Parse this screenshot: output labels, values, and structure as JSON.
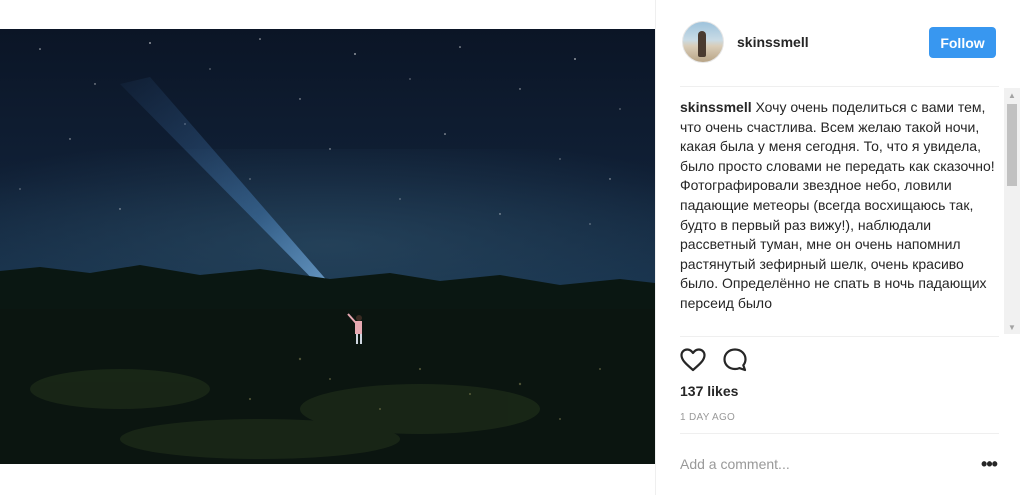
{
  "post": {
    "username": "skinssmell",
    "follow_label": "Follow",
    "caption": {
      "author": "skinssmell",
      "text": "Хочу очень поделиться с вами тем, что очень счастлива. Всем желаю такой ночи, какая была у меня сегодня. То, что я увидела, было просто словами не передать как сказочно! Фотографировали звездное небо, ловили падающие метеоры (всегда восхищаюсь так, будто в первый раз вижу!), наблюдали рассветный туман, мне он очень напомнил растянутый зефирный шелк, очень красиво было. Определённо не спать в ночь падающих персеид было"
    },
    "likes": "137 likes",
    "timestamp": "1 DAY AGO",
    "comment_placeholder": "Add a comment...",
    "more_label": "•••",
    "icons": {
      "like": "heart-icon",
      "comment": "comment-bubble-icon",
      "more": "more-options-icon"
    },
    "colors": {
      "follow_button": "#3897f0",
      "text": "#262626",
      "muted": "#999999"
    }
  }
}
